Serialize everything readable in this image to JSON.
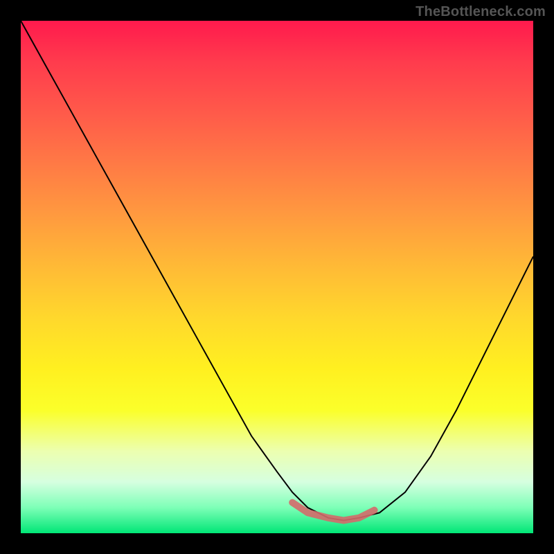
{
  "watermark": "TheBottleneck.com",
  "chart_data": {
    "type": "line",
    "title": "",
    "xlabel": "",
    "ylabel": "",
    "xlim": [
      0,
      100
    ],
    "ylim": [
      0,
      100
    ],
    "grid": false,
    "series": [
      {
        "name": "bottleneck-curve",
        "x": [
          0,
          5,
          10,
          15,
          20,
          25,
          30,
          35,
          40,
          45,
          50,
          53,
          56,
          60,
          63,
          66,
          70,
          75,
          80,
          85,
          90,
          95,
          100
        ],
        "y": [
          100,
          91,
          82,
          73,
          64,
          55,
          46,
          37,
          28,
          19,
          12,
          8,
          5,
          3,
          2.5,
          3,
          4,
          8,
          15,
          24,
          34,
          44,
          54
        ]
      },
      {
        "name": "optimal-range-highlight",
        "x": [
          53,
          56,
          60,
          63,
          66,
          69
        ],
        "y": [
          6,
          4,
          3,
          2.5,
          3,
          4.5
        ]
      }
    ],
    "annotations": [],
    "legend": false
  }
}
